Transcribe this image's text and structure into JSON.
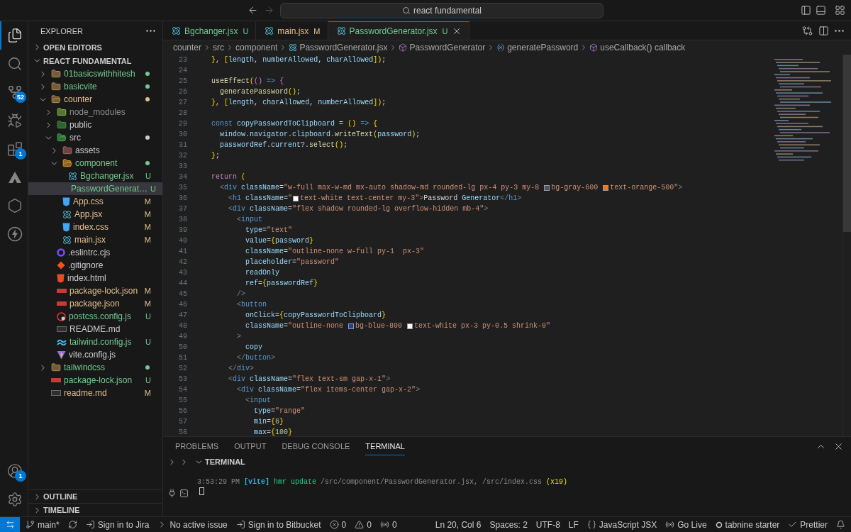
{
  "title_bar": {
    "nav": [
      {
        "kind": "back",
        "disabled": false
      },
      {
        "kind": "forward",
        "disabled": true
      }
    ],
    "search": "react fundamental"
  },
  "activity_bar": {
    "top": [
      {
        "kind": "explorer",
        "selected": true
      },
      {
        "kind": "search",
        "selected": false
      },
      {
        "kind": "source-control",
        "selected": false,
        "badge": "52"
      },
      {
        "kind": "run-debug",
        "selected": false
      },
      {
        "kind": "extensions",
        "selected": false,
        "badge": "1"
      },
      {
        "kind": "atlassian",
        "selected": false
      },
      {
        "kind": "hexagon",
        "selected": false
      },
      {
        "kind": "lightning",
        "selected": false
      }
    ],
    "bottom": [
      {
        "kind": "accounts",
        "badge": "1"
      },
      {
        "kind": "settings"
      }
    ]
  },
  "explorer": {
    "title": "EXPLORER",
    "sections": [
      {
        "label": "OPEN EDITORS",
        "expanded": false
      },
      {
        "label": "REACT FUNDAMENTAL",
        "expanded": true,
        "tree": [
          {
            "label": "01basicswithhitesh",
            "kind": "folder",
            "color": "#73c991",
            "dot": true,
            "expanded": false,
            "selected": false
          },
          {
            "label": "basicvite",
            "kind": "folder",
            "color": "#73c991",
            "dot": true,
            "expanded": false,
            "selected": false
          },
          {
            "label": "counter",
            "kind": "folder",
            "color": "#e2c08d",
            "dot": true,
            "expanded": true,
            "selected": false,
            "children": [
              {
                "label": "node_modules",
                "kind": "folder-node",
                "color": "#8c8c8c",
                "expanded": false,
                "selected": false
              },
              {
                "label": "public",
                "kind": "folder-public",
                "color": "#cccccc",
                "expanded": false,
                "selected": false
              },
              {
                "label": "src",
                "kind": "folder-src",
                "color": "#cccccc",
                "dot": true,
                "expanded": true,
                "selected": false,
                "children": [
                  {
                    "label": "assets",
                    "kind": "folder-assets",
                    "color": "#cccccc",
                    "expanded": false,
                    "selected": false
                  },
                  {
                    "label": "component",
                    "kind": "folder-component",
                    "color": "#73c991",
                    "dot": true,
                    "expanded": true,
                    "selected": false,
                    "children": [
                      {
                        "label": "Bgchanger.jsx",
                        "kind": "react",
                        "color": "#73c991",
                        "badge": "U",
                        "selected": false
                      },
                      {
                        "label": "PasswordGenerat…",
                        "kind": "react",
                        "color": "#73c991",
                        "badge": "U",
                        "selected": true
                      }
                    ]
                  },
                  {
                    "label": "App.css",
                    "kind": "css",
                    "color": "#e2c08d",
                    "badge": "M",
                    "selected": false
                  },
                  {
                    "label": "App.jsx",
                    "kind": "react",
                    "color": "#e2c08d",
                    "badge": "M",
                    "selected": false
                  },
                  {
                    "label": "index.css",
                    "kind": "css",
                    "color": "#e2c08d",
                    "badge": "M",
                    "selected": false
                  },
                  {
                    "label": "main.jsx",
                    "kind": "react",
                    "color": "#e2c08d",
                    "badge": "M",
                    "selected": false
                  }
                ]
              },
              {
                "label": ".eslintrc.cjs",
                "kind": "eslint",
                "color": "#cccccc",
                "selected": false
              },
              {
                "label": ".gitignore",
                "kind": "git",
                "color": "#cccccc",
                "selected": false
              },
              {
                "label": "index.html",
                "kind": "html",
                "color": "#cccccc",
                "selected": false
              },
              {
                "label": "package-lock.json",
                "kind": "npm",
                "color": "#e2c08d",
                "badge": "M",
                "selected": false
              },
              {
                "label": "package.json",
                "kind": "npm",
                "color": "#e2c08d",
                "badge": "M",
                "selected": false
              },
              {
                "label": "postcss.config.js",
                "kind": "postcss",
                "color": "#73c991",
                "badge": "U",
                "selected": false
              },
              {
                "label": "README.md",
                "kind": "md",
                "color": "#cccccc",
                "selected": false
              },
              {
                "label": "tailwind.config.js",
                "kind": "tailwind",
                "color": "#73c991",
                "badge": "U",
                "selected": false
              },
              {
                "label": "vite.config.js",
                "kind": "vite",
                "color": "#cccccc",
                "selected": false
              }
            ]
          },
          {
            "label": "tailwindcss",
            "kind": "folder",
            "color": "#73c991",
            "dot": true,
            "expanded": false,
            "selected": false
          },
          {
            "label": "package-lock.json",
            "kind": "npm",
            "color": "#73c991",
            "badge": "U",
            "selected": false
          },
          {
            "label": "readme.md",
            "kind": "md",
            "color": "#e2c08d",
            "badge": "M",
            "selected": false
          }
        ]
      }
    ],
    "bottom_sections": [
      {
        "label": "OUTLINE",
        "expanded": false
      },
      {
        "label": "TIMELINE",
        "expanded": false
      }
    ]
  },
  "tabs": [
    {
      "label": "Bgchanger.jsx",
      "badge": "U",
      "color": "#73c991",
      "selected": false
    },
    {
      "label": "main.jsx",
      "badge": "M",
      "color": "#e2c08d",
      "selected": false
    },
    {
      "label": "PasswordGenerator.jsx",
      "badge": "U",
      "color": "#73c991",
      "selected": true
    }
  ],
  "breadcrumbs": [
    {
      "label": "counter"
    },
    {
      "label": "src"
    },
    {
      "label": "component"
    },
    {
      "label": "PasswordGenerator.jsx",
      "kind": "react"
    },
    {
      "label": "PasswordGenerator",
      "kind": "component"
    },
    {
      "label": "generatePassword",
      "kind": "variable"
    },
    {
      "label": "useCallback() callback",
      "kind": "method"
    }
  ],
  "editor": {
    "lines": [
      {
        "number": "23",
        "parts": [
          "  }, [length, numberAllowed, charAllowed]);"
        ]
      },
      {
        "number": "24"
      },
      {
        "number": "25",
        "parts": [
          "  useEffect(() => {"
        ]
      },
      {
        "number": "26",
        "parts": [
          "    generatePassword();"
        ]
      },
      {
        "number": "27",
        "parts": [
          "  }, [length, charAllowed, numberAllowed]);"
        ]
      },
      {
        "number": "28"
      },
      {
        "number": "29",
        "parts": [
          "  const copyPasswordToClipboard = () => {"
        ]
      },
      {
        "number": "30",
        "parts": [
          "    window.navigator.clipboard.writeText(password);"
        ]
      },
      {
        "number": "31",
        "parts": [
          "    passwordRef.current?.select();"
        ]
      },
      {
        "number": "32",
        "parts": [
          "  };"
        ]
      },
      {
        "number": "33"
      },
      {
        "number": "34",
        "parts": [
          "  return ("
        ]
      },
      {
        "number": "35",
        "parts": [
          "    <div className=\"w-full max-w-md mx-auto shadow-md rounded-lg px-4 py-3 my-8 ",
          {
            "color": "#4b5563"
          },
          "bg-gray-600 ",
          {
            "color": "#f97316"
          },
          "text-orange-500\">"
        ]
      },
      {
        "number": "36",
        "parts": [
          "      <h1 className=\"",
          {
            "color": "#ffffff"
          },
          "text-white text-center my-3\">Password Generator</h1>"
        ]
      },
      {
        "number": "37",
        "parts": [
          "      <div className=\"flex shadow rounded-lg overflow-hidden mb-4\">"
        ]
      },
      {
        "number": "38",
        "parts": [
          "        <input"
        ]
      },
      {
        "number": "39",
        "parts": [
          "          type=\"text\""
        ]
      },
      {
        "number": "40",
        "parts": [
          "          value={password}"
        ]
      },
      {
        "number": "41",
        "parts": [
          "          className=\"outline-none w-full py-1  px-3\""
        ]
      },
      {
        "number": "42",
        "parts": [
          "          placeholder=\"password\""
        ]
      },
      {
        "number": "43",
        "parts": [
          "          readOnly"
        ]
      },
      {
        "number": "44",
        "parts": [
          "          ref={passwordRef}"
        ]
      },
      {
        "number": "45",
        "parts": [
          "        />"
        ]
      },
      {
        "number": "46",
        "parts": [
          "        <button"
        ]
      },
      {
        "number": "47",
        "parts": [
          "          onClick={copyPasswordToClipboard}"
        ]
      },
      {
        "number": "48",
        "parts": [
          "          className=\"outline-none ",
          {
            "color": "#1e40af"
          },
          "bg-blue-800 ",
          {
            "color": "#ffffff"
          },
          "text-white px-3 py-0.5 shrink-0\""
        ]
      },
      {
        "number": "49",
        "parts": [
          "        >"
        ]
      },
      {
        "number": "50",
        "parts": [
          "          copy"
        ]
      },
      {
        "number": "51",
        "parts": [
          "        </button>"
        ]
      },
      {
        "number": "52",
        "parts": [
          "      </div>"
        ]
      },
      {
        "number": "53",
        "parts": [
          "      <div className=\"flex text-sm gap-x-1\">"
        ]
      },
      {
        "number": "54",
        "parts": [
          "        <div className=\"flex items-center gap-x-2\">"
        ]
      },
      {
        "number": "55",
        "parts": [
          "          <input"
        ]
      },
      {
        "number": "56",
        "parts": [
          "            type=\"range\""
        ]
      },
      {
        "number": "57",
        "parts": [
          "            min={6}"
        ]
      },
      {
        "number": "58",
        "parts": [
          "            max={100}"
        ]
      }
    ]
  },
  "panel": {
    "tabs": [
      {
        "label": "PROBLEMS",
        "selected": false
      },
      {
        "label": "OUTPUT",
        "selected": false
      },
      {
        "label": "DEBUG CONSOLE",
        "selected": false
      },
      {
        "label": "TERMINAL",
        "selected": true
      }
    ],
    "terminal": {
      "title": "TERMINAL",
      "output": "3:53:29 PM [vite] hmr update /src/component/PasswordGenerator.jsx, /src/index.css (x19)"
    }
  },
  "status_bar": {
    "left": [
      {
        "kind": "branch",
        "label": "main*"
      },
      {
        "kind": "sync"
      },
      {
        "kind": "signin",
        "label": "Sign in to Jira"
      },
      {
        "kind": "chevron",
        "label": "No active issue"
      },
      {
        "kind": "signin",
        "label": "Sign in to Bitbucket"
      },
      {
        "kind": "error",
        "label": "0"
      },
      {
        "kind": "warning",
        "label": "0"
      },
      {
        "kind": "ports",
        "label": "0"
      }
    ],
    "right": [
      {
        "label": "Ln 20, Col 6"
      },
      {
        "label": "Spaces: 2"
      },
      {
        "label": "UTF-8"
      },
      {
        "label": "LF"
      },
      {
        "kind": "braces",
        "label": "JavaScript JSX"
      },
      {
        "kind": "live",
        "label": "Go Live"
      },
      {
        "kind": "tabnine",
        "label": "tabnine starter"
      },
      {
        "kind": "check",
        "label": "Prettier"
      },
      {
        "kind": "bell"
      }
    ]
  }
}
